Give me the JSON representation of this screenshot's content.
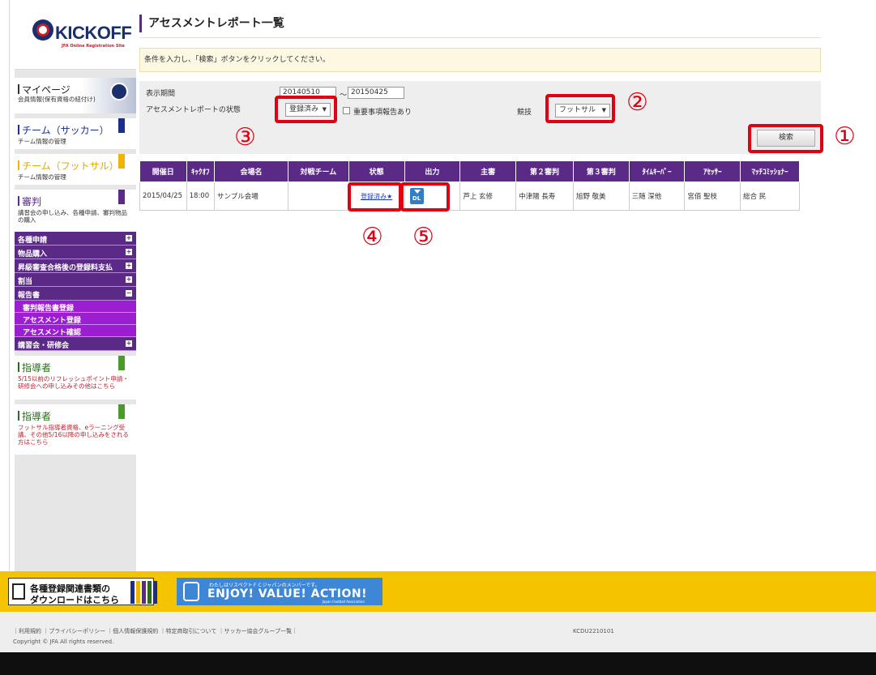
{
  "logo": {
    "text": "KICKOFF",
    "sub": "JFA Online Registration Site"
  },
  "sidebar": {
    "mypage": {
      "title": "マイページ",
      "desc": "会員情報(保有資格の紐付け)"
    },
    "panels": [
      {
        "title": "チーム（サッカー）",
        "desc": "チーム情報の管理",
        "color": "#1a2f8b"
      },
      {
        "title": "チーム（フットサル）",
        "desc": "チーム情報の管理",
        "color": "#f0b400"
      },
      {
        "title": "審判",
        "desc": "講習会の申し込み、各種申請、審判物品の購入",
        "color": "#5b2a86"
      }
    ],
    "menu": [
      {
        "label": "各種申請",
        "toggle": "+"
      },
      {
        "label": "物品購入",
        "toggle": "+"
      },
      {
        "label": "昇級審査合格後の登録料支払",
        "toggle": "+"
      },
      {
        "label": "割当",
        "toggle": "+"
      },
      {
        "label": "報告書",
        "toggle": "−"
      }
    ],
    "submenu": [
      "審判報告書登録",
      "アセスメント登録",
      "アセスメント確認"
    ],
    "menu_after": {
      "label": "講習会・研修会",
      "toggle": "+"
    },
    "coach1": {
      "title": "指導者",
      "desc": "5/15以前のリフレッシュポイント申請・研修会への申し込みその他はこちら"
    },
    "coach2": {
      "title": "指導者",
      "desc": "フットサル指導者資格、eラーニング受講、その他5/16以降の申し込みをされる方はこちら"
    }
  },
  "main": {
    "title": "アセスメントレポート一覧",
    "notice": "条件を入力し、「検索」ボタンをクリックしてください。",
    "search": {
      "period_label": "表示期間",
      "date_from": "20140510",
      "tilde": "～",
      "date_to": "20150425",
      "status_label": "アセスメントレポートの状態",
      "status_value": "登録済み",
      "important_label": "重要事項報告あり",
      "sport_label": "競技",
      "sport_value": "フットサル",
      "search_button": "検索"
    },
    "table": {
      "headers": [
        "開催日",
        "ｷｯｸｵﾌ",
        "会場名",
        "対戦チーム",
        "状態",
        "出力",
        "主審",
        "第２審判",
        "第３審判",
        "ﾀｲﾑｷｰﾊﾟｰ",
        "ｱｾｯｻｰ",
        "ﾏｯﾁｺﾐｯｼｮﾅｰ"
      ],
      "row": {
        "date": "2015/04/25",
        "kickoff": "18:00",
        "venue": "サンプル会場",
        "opponent": "",
        "status": "登録済み★",
        "output": "DL",
        "referee": "芦上 玄修",
        "second": "中津陽 長寿",
        "third": "旭野 敬美",
        "timekeeper": "三随 深他",
        "assessor": "宮佰 聖枝",
        "commissioner": "総合 民"
      }
    },
    "callouts": [
      "①",
      "②",
      "③",
      "④",
      "⑤"
    ]
  },
  "footer": {
    "dl_banner_line1": "各種登録関連書類の",
    "dl_banner_line2": "ダウンロードはこちら",
    "enjoy_small": "わたしはリスペクトＦＣジャパンのメンバーです。",
    "enjoy_big": "ENJOY! VALUE! ACTION!",
    "enjoy_jfa": "Japan Football Association",
    "links": "｜利用規約 ｜プライバシーポリシー ｜個人情報保護規約 ｜特定商取引について ｜サッカー協会グループ一覧｜",
    "copyright": "Copyright © JFA All rights reserved.",
    "code": "KCDU2210101"
  },
  "colors": {
    "accent": "#5b2a86",
    "callout": "#e00012",
    "banner": "#f5c400"
  }
}
